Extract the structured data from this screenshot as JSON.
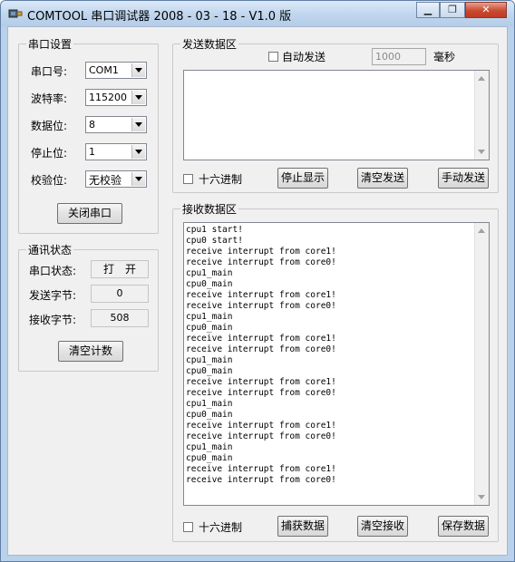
{
  "window": {
    "title": "COMTOOL 串口调试器 2008 - 03 - 18 - V1.0 版",
    "minimize": "▁",
    "restore": "❐",
    "close": "✕"
  },
  "serial_settings": {
    "group_title": "串口设置",
    "port_label": "串口号:",
    "port_value": "COM1",
    "baud_label": "波特率:",
    "baud_value": "115200",
    "databits_label": "数据位:",
    "databits_value": "8",
    "stopbits_label": "停止位:",
    "stopbits_value": "1",
    "parity_label": "校验位:",
    "parity_value": "无校验",
    "close_port_button": "关闭串口"
  },
  "comm_status": {
    "group_title": "通讯状态",
    "port_status_label": "串口状态:",
    "port_status_value": "打　开",
    "sent_bytes_label": "发送字节:",
    "sent_bytes_value": "0",
    "recv_bytes_label": "接收字节:",
    "recv_bytes_value": "508",
    "clear_count_button": "清空计数"
  },
  "send_area": {
    "group_title": "发送数据区",
    "auto_send_label": "自动发送",
    "interval_value": "1000",
    "interval_unit": "毫秒",
    "hex_label": "十六进制",
    "stop_display_button": "停止显示",
    "clear_send_button": "清空发送",
    "manual_send_button": "手动发送"
  },
  "receive_area": {
    "group_title": "接收数据区",
    "lines": [
      "cpu1 start!",
      "cpu0 start!",
      "receive interrupt from core1!",
      "receive interrupt from core0!",
      "cpu1_main",
      "cpu0_main",
      "receive interrupt from core1!",
      "receive interrupt from core0!",
      "cpu1_main",
      "cpu0_main",
      "receive interrupt from core1!",
      "receive interrupt from core0!",
      "cpu1_main",
      "cpu0_main",
      "receive interrupt from core1!",
      "receive interrupt from core0!",
      "cpu1_main",
      "cpu0_main",
      "receive interrupt from core1!",
      "receive interrupt from core0!",
      "cpu1_main",
      "cpu0_main",
      "receive interrupt from core1!",
      "receive interrupt from core0!"
    ],
    "hex_label": "十六进制",
    "capture_button": "捕获数据",
    "clear_recv_button": "清空接收",
    "save_button": "保存数据"
  }
}
